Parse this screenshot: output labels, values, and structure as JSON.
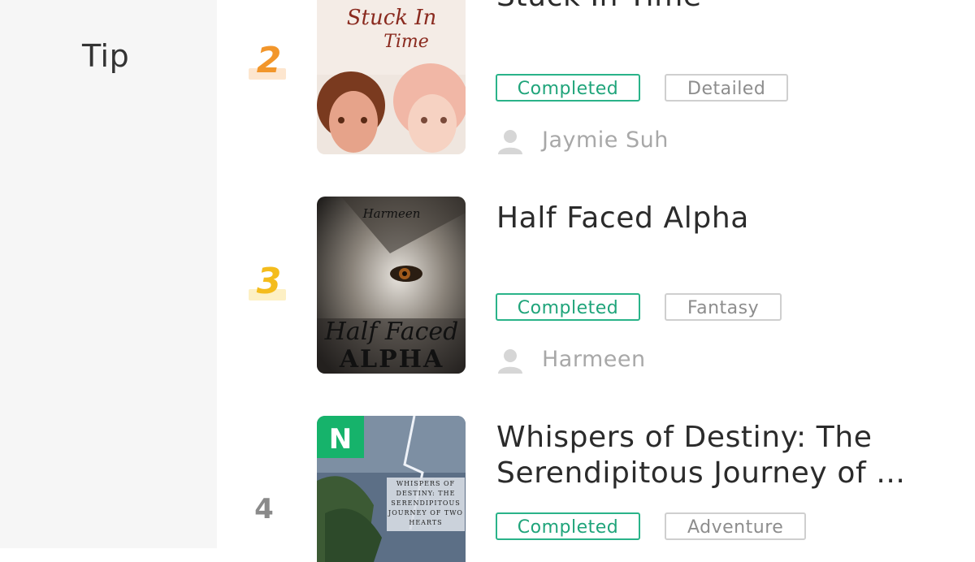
{
  "sidebar": {
    "active_label": "Tip"
  },
  "books": [
    {
      "rank": "2",
      "title": "Stuck In Time",
      "status": "Completed",
      "genre": "Detailed",
      "author": "Jaymie Suh",
      "cover_text": [
        "Stuck In",
        "Time"
      ]
    },
    {
      "rank": "3",
      "title": "Half Faced Alpha",
      "status": "Completed",
      "genre": "Fantasy",
      "author": "Harmeen",
      "cover_text": [
        "Harmeen",
        "Half Faced",
        "ALPHA"
      ]
    },
    {
      "rank": "4",
      "title": "Whispers of Destiny: The Serendipitous Journey of ...",
      "status": "Completed",
      "genre": "Adventure",
      "cover_text": [
        "WHISPERS OF",
        "DESTINY: THE",
        "SERENDIPITOUS",
        "JOURNEY OF TWO",
        "HEARTS"
      ],
      "cover_badge": "N"
    }
  ],
  "colors": {
    "rank_2": "#f2962b",
    "rank_3": "#f4bc1c",
    "rank_4": "#8a8a8a",
    "status_green": "#1fa47a",
    "badge_green": "#16b36b"
  },
  "icons": {
    "author": "person-icon"
  }
}
